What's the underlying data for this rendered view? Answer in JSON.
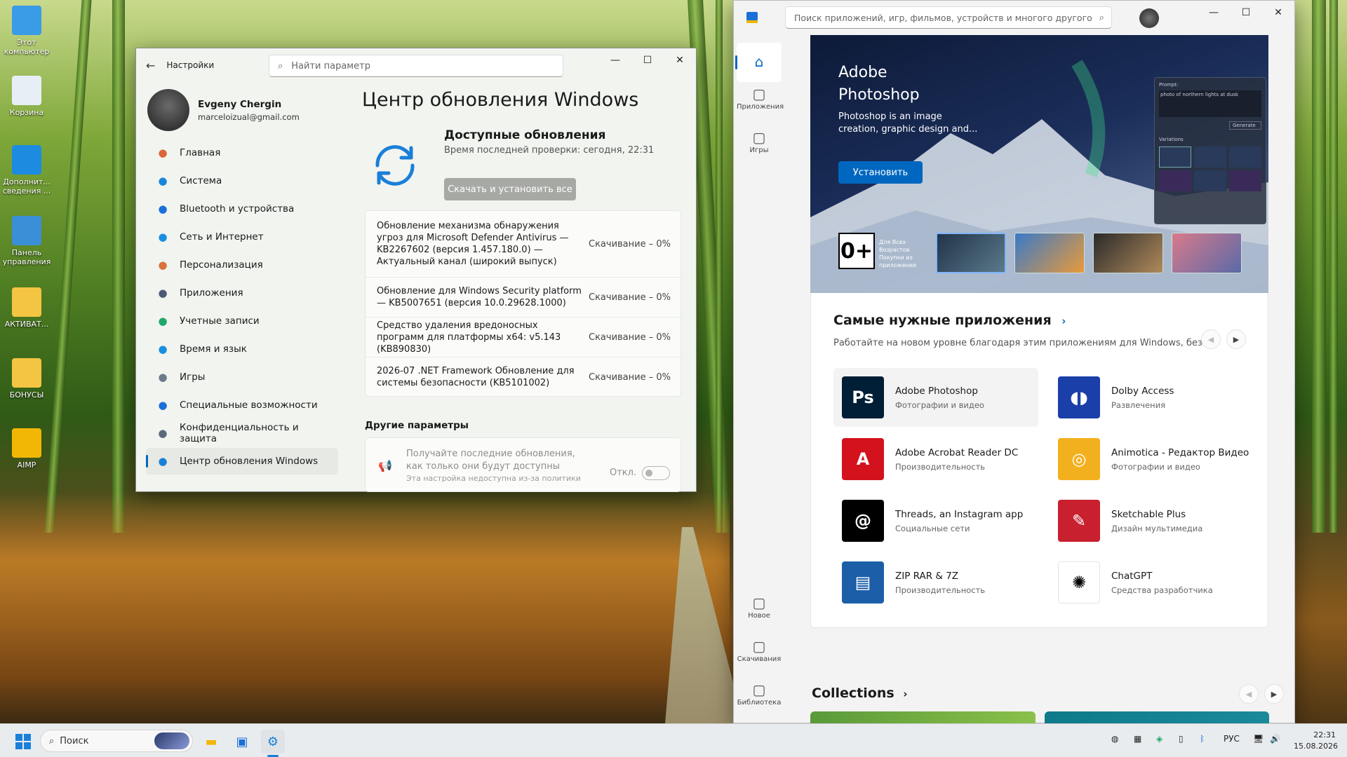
{
  "desktop": {
    "icons": [
      {
        "label": "Этот компьютер",
        "icon": "monitor-icon",
        "color": "#3a9be6"
      },
      {
        "label": "Корзина",
        "icon": "recycle-bin-icon",
        "color": "#e7eef6"
      },
      {
        "label": "Дополнит... сведения ...",
        "icon": "info-image-icon",
        "color": "#1d8be0"
      },
      {
        "label": "Панель управления",
        "icon": "control-panel-icon",
        "color": "#3b8fd6"
      },
      {
        "label": "АКТИВАТ...",
        "icon": "folder-icon",
        "color": "#f4c542"
      },
      {
        "label": "БОНУСЫ",
        "icon": "folder-icon",
        "color": "#f4c542"
      },
      {
        "label": "AIMP",
        "icon": "aimp-icon",
        "color": "#f2b705"
      }
    ]
  },
  "settings": {
    "title": "Настройки",
    "search_placeholder": "Найти параметр",
    "user": {
      "name": "Evgeny Chergin",
      "email": "marceloizual@gmail.com"
    },
    "nav": [
      {
        "label": "Главная",
        "icon": "home-icon",
        "color": "#d9663a"
      },
      {
        "label": "Система",
        "icon": "system-icon",
        "color": "#1a86d9"
      },
      {
        "label": "Bluetooth и устройства",
        "icon": "bluetooth-icon",
        "color": "#1a6fd9"
      },
      {
        "label": "Сеть и Интернет",
        "icon": "wifi-icon",
        "color": "#1a8fe0"
      },
      {
        "label": "Персонализация",
        "icon": "brush-icon",
        "color": "#d9733a"
      },
      {
        "label": "Приложения",
        "icon": "apps-icon",
        "color": "#4a5a78"
      },
      {
        "label": "Учетные записи",
        "icon": "account-icon",
        "color": "#20a86a"
      },
      {
        "label": "Время и язык",
        "icon": "globe-clock-icon",
        "color": "#1a8fe0"
      },
      {
        "label": "Игры",
        "icon": "gamepad-icon",
        "color": "#6a7a8a"
      },
      {
        "label": "Специальные возможности",
        "icon": "accessibility-icon",
        "color": "#1a6fd9"
      },
      {
        "label": "Конфиденциальность и защита",
        "icon": "shield-icon",
        "color": "#5a6a7a"
      },
      {
        "label": "Центр обновления Windows",
        "icon": "windows-update-icon",
        "color": "#1a7fd9"
      }
    ],
    "selected_nav_index": 11,
    "page_title": "Центр обновления Windows",
    "status_title": "Доступные обновления",
    "status_subtitle": "Время последней проверки: сегодня, 22:31",
    "download_button": "Скачать и установить все",
    "updates": [
      {
        "name": "Обновление механизма обнаружения угроз для Microsoft Defender Antivirus — KB2267602 (версия 1.457.180.0) — Актуальный канал (широкий выпуск)",
        "status": "Скачивание – 0%"
      },
      {
        "name": "Обновление для Windows Security platform — KB5007651 (версия 10.0.29628.1000)",
        "status": "Скачивание – 0%"
      },
      {
        "name": "Средство удаления вредоносных программ для платформы x64: v5.143 (KB890830)",
        "status": "Скачивание – 0%"
      },
      {
        "name": "2026-07 .NET Framework Обновление для системы безопасности (KB5101002)",
        "status": "Скачивание – 0%"
      }
    ],
    "other_params_title": "Другие параметры",
    "latest_updates_text": "Получайте последние обновления, как только они будут доступны",
    "latest_updates_note": "Эта настройка недоступна из-за политики",
    "toggle_label": "Откл.",
    "toggle_on": false
  },
  "store": {
    "search_placeholder": "Поиск приложений, игр, фильмов, устройств и многого другого",
    "rail": [
      {
        "label": "",
        "icon": "home-icon",
        "selected": true
      },
      {
        "label": "Приложения",
        "icon": "apps-icon"
      },
      {
        "label": "Игры",
        "icon": "gamepad-icon"
      },
      {
        "label": "Новое",
        "icon": "new-icon"
      },
      {
        "label": "Скачивания",
        "icon": "downloads-icon"
      },
      {
        "label": "Библиотека",
        "icon": "library-icon"
      }
    ],
    "hero": {
      "title": "Adobe Photoshop",
      "description": "Photoshop is an image creation, graphic design and...",
      "install_button": "Установить",
      "age_rating": "0+",
      "age_rating_text": "Для Всех Возрастов Покупки из приложения",
      "prompt_label": "Prompt:",
      "prompt_text": "photo of northern lights at dusk",
      "generate_label": "Generate",
      "variations_label": "Variations"
    },
    "section_title": "Самые нужные приложения",
    "section_subtitle": "Работайте на новом уровне благодаря этим приложениям для Windows, без...",
    "apps": [
      {
        "name": "Adobe Photoshop",
        "category": "Фотографии и видео",
        "icon": "photoshop-icon",
        "color": "#001e36",
        "glyph": "Ps"
      },
      {
        "name": "Dolby Access",
        "category": "Развлечения",
        "icon": "dolby-icon",
        "color": "#1b3fa8",
        "glyph": "◖◗"
      },
      {
        "name": "Adobe Acrobat Reader DC",
        "category": "Производительность",
        "icon": "acrobat-icon",
        "color": "#d3121e",
        "glyph": "A"
      },
      {
        "name": "Animotica - Редактор Видео",
        "category": "Фотографии и видео",
        "icon": "animotica-icon",
        "color": "#f2b01e",
        "glyph": "◎"
      },
      {
        "name": "Threads, an Instagram app",
        "category": "Социальные сети",
        "icon": "threads-icon",
        "color": "#000000",
        "glyph": "@"
      },
      {
        "name": "Sketchable Plus",
        "category": "Дизайн мультимедиа",
        "icon": "sketchable-icon",
        "color": "#c8202e",
        "glyph": "✎"
      },
      {
        "name": "ZIP RAR & 7Z",
        "category": "Производительность",
        "icon": "archive-icon",
        "color": "#1c5fa8",
        "glyph": "▤"
      },
      {
        "name": "ChatGPT",
        "category": "Средства разработчика",
        "icon": "chatgpt-icon",
        "color": "#ffffff",
        "glyph": "✺"
      }
    ],
    "collections_title": "Collections"
  },
  "taskbar": {
    "search_placeholder": "Поиск",
    "language": "РУС",
    "time": "22:31",
    "date": "15.08.2026"
  }
}
